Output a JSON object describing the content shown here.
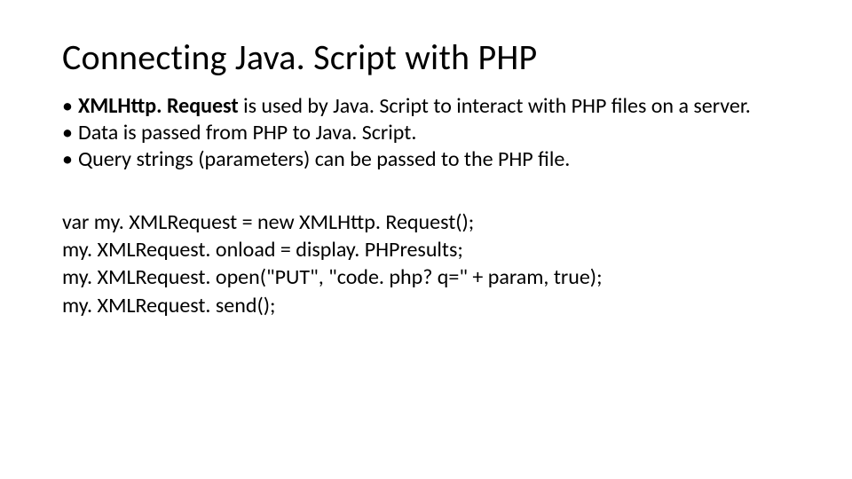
{
  "title": "Connecting Java. Script with PHP",
  "bullets": [
    {
      "pre": " ",
      "strong": "XMLHttp. Request",
      "post": "  is used by Java. Script to interact with PHP files on a server."
    },
    {
      "pre": "",
      "strong": "",
      "post": "Data is passed from PHP to Java. Script."
    },
    {
      "pre": "",
      "strong": "",
      "post": "Query strings (parameters) can be passed to the PHP file."
    }
  ],
  "code": [
    "var my. XMLRequest = new XMLHttp. Request();",
    "my. XMLRequest. onload = display. PHPresults;",
    "my. XMLRequest. open(\"PUT\", \"code. php? q=\" + param, true);",
    "my. XMLRequest. send();"
  ]
}
